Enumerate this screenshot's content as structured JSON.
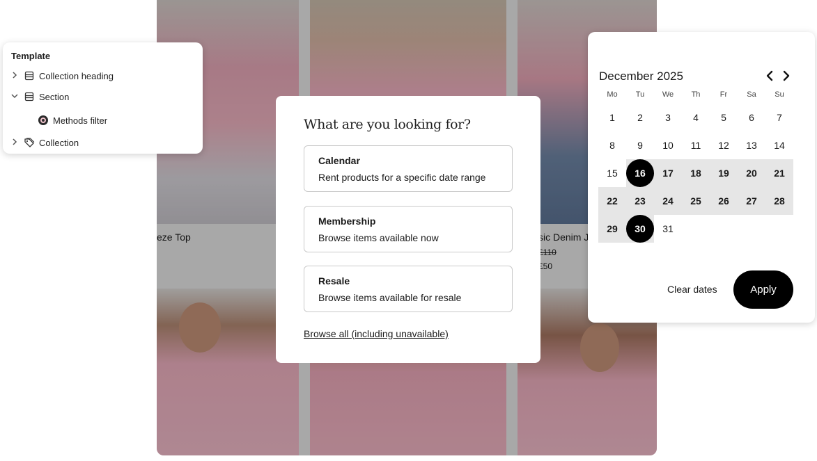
{
  "grid": {
    "captions": [
      "eze Top",
      "sic Denim J"
    ],
    "old_price": "£110",
    "new_price": "£50"
  },
  "tree": {
    "title": "Template",
    "items": [
      {
        "label": "Collection heading",
        "icon": "layout-section-icon",
        "expanded": false
      },
      {
        "label": "Section",
        "icon": "layout-section-icon",
        "expanded": true
      },
      {
        "label": "Methods filter",
        "icon": "app-block-icon"
      },
      {
        "label": "Collection",
        "icon": "tag-icon",
        "expanded": false
      }
    ]
  },
  "modal": {
    "title": "What are you looking for?",
    "options": [
      {
        "title": "Calendar",
        "description": "Rent products for a specific date range"
      },
      {
        "title": "Membership",
        "description": "Browse items available now"
      },
      {
        "title": "Resale",
        "description": "Browse items available for resale"
      }
    ],
    "browse_all": "Browse all (including unavailable)"
  },
  "calendar": {
    "month": "December 2025",
    "weekdays": [
      "Mo",
      "Tu",
      "We",
      "Th",
      "Fr",
      "Sa",
      "Su"
    ],
    "days": [
      "1",
      "2",
      "3",
      "4",
      "5",
      "6",
      "7",
      "8",
      "9",
      "10",
      "11",
      "12",
      "13",
      "14",
      "15",
      "16",
      "17",
      "18",
      "19",
      "20",
      "21",
      "22",
      "23",
      "24",
      "25",
      "26",
      "27",
      "28",
      "29",
      "30",
      "31"
    ],
    "first_weekday_index": 0,
    "range_start": 16,
    "range_end": 30,
    "clear_label": "Clear dates",
    "apply_label": "Apply"
  },
  "colors": {
    "accent": "#000000",
    "range_fill": "#e6e6e6"
  }
}
